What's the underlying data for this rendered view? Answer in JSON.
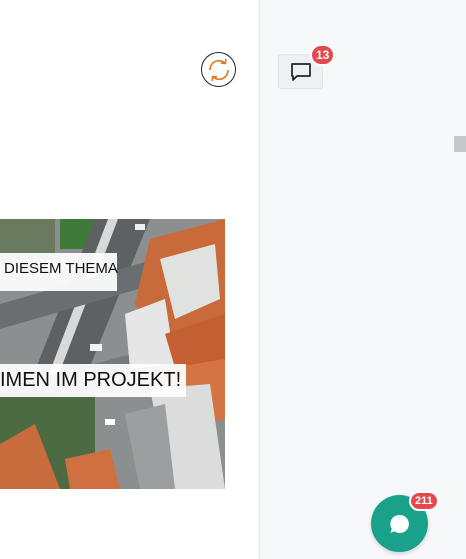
{
  "header": {
    "sync_icon": "sync-icon",
    "comment_icon": "comment-icon",
    "comment_count": "13"
  },
  "post_image": {
    "caption_top": "DIESEM THEMA",
    "caption_bottom": "IMEN IM PROJEKT!"
  },
  "chat": {
    "icon": "chat-bubble-icon",
    "unread_count": "211",
    "fab_color": "#1aa18a",
    "badge_color": "#e5484d"
  }
}
